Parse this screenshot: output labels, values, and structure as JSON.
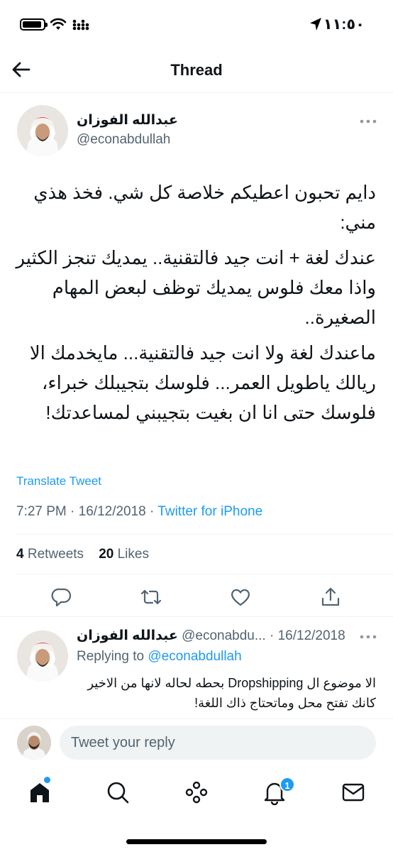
{
  "status_bar": {
    "time": "١١:٥٠"
  },
  "header": {
    "title": "Thread"
  },
  "tweet": {
    "author_name": "عبدالله الفوزان",
    "author_handle": "@econabdullah",
    "paragraphs": [
      "دايم تحبون اعطيكم خلاصة كل شي. فخذ هذي مني:",
      "عندك لغة + انت جيد فالتقنية.. يمديك تنجز الكثير واذا معك فلوس يمديك توظف لبعض المهام الصغيرة..",
      "ماعندك لغة ولا انت جيد فالتقنية... مايخدمك الا ريالك ياطويل العمر... فلوسك بتجيبلك خبراء، فلوسك حتى انا ان بغيت بتجيبني لمساعدتك!"
    ],
    "translate_label": "Translate Tweet",
    "time": "7:27 PM",
    "date": "16/12/2018",
    "source": "Twitter for iPhone",
    "retweets_count": "4",
    "retweets_label": "Retweets",
    "likes_count": "20",
    "likes_label": "Likes"
  },
  "reply": {
    "author_name": "عبدالله الفوزان",
    "author_handle": "@econabdu...",
    "date": "16/12/2018",
    "replying_label": "Replying to",
    "replying_to": "@econabdullah",
    "text": "الا موضوع ال Dropshipping بحطه لحاله لانها من الاخير كانك تفتح محل وماتحتاج ذاك اللغة!"
  },
  "reply_bar": {
    "placeholder": "Tweet your reply"
  },
  "tabbar": {
    "notification_count": "1"
  },
  "colors": {
    "accent": "#1d9bf0",
    "text": "#0f1419",
    "muted": "#536471"
  }
}
